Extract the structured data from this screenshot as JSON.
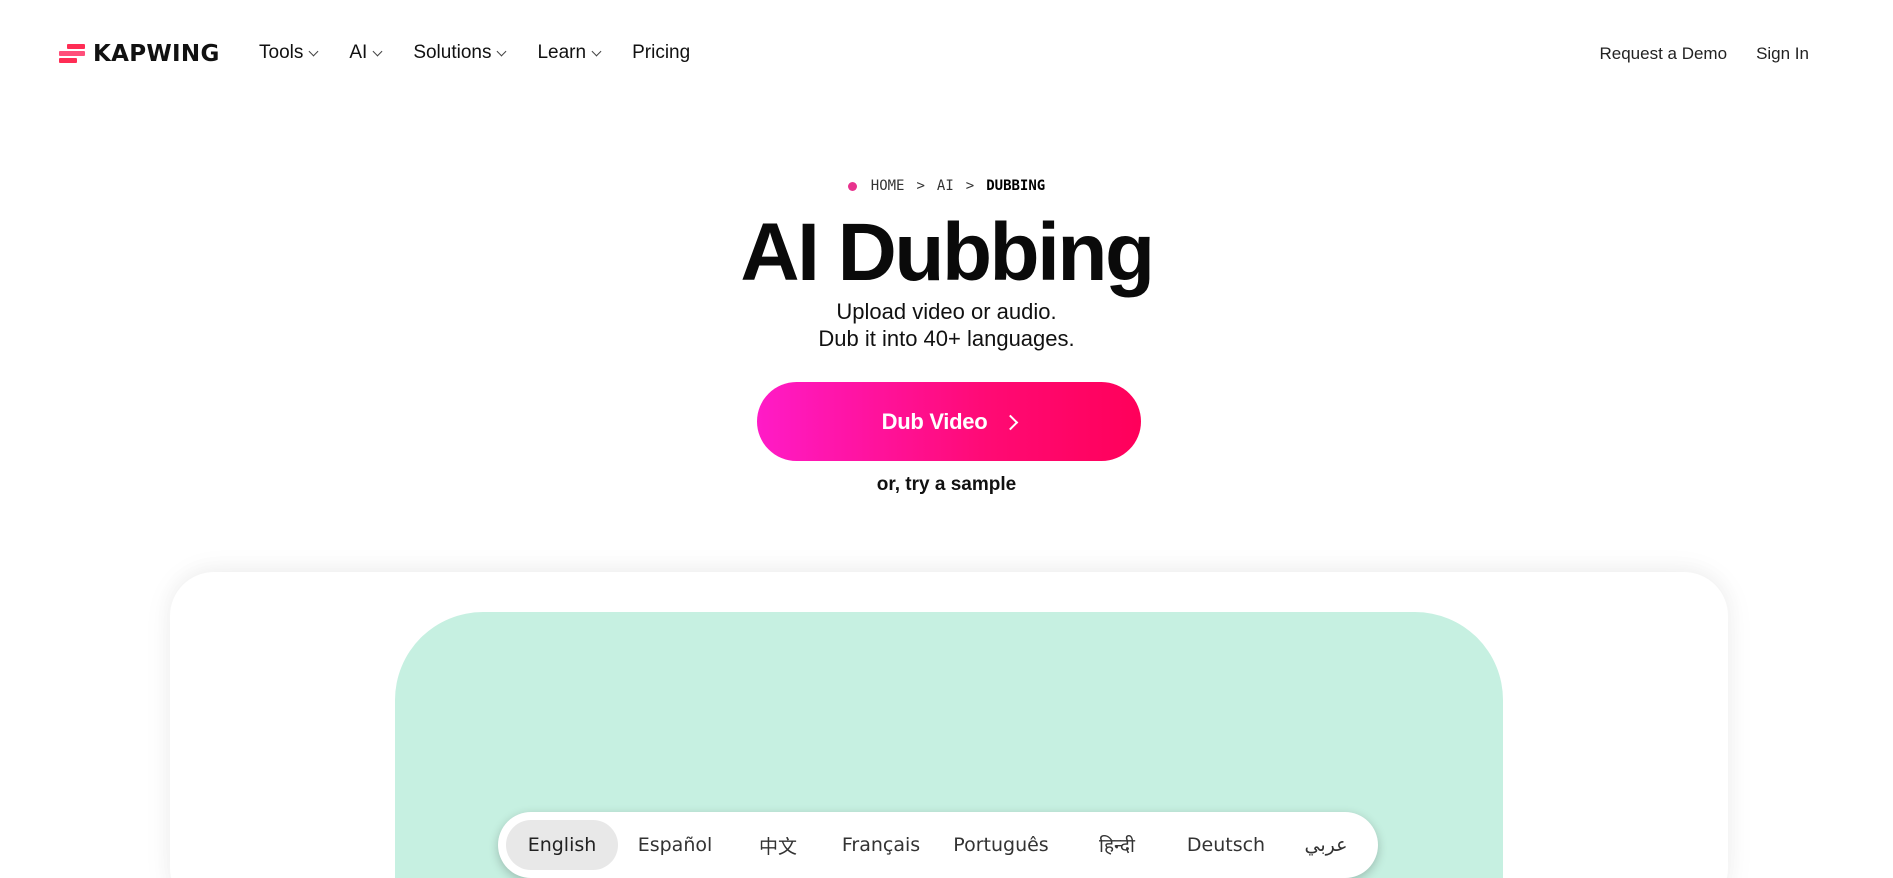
{
  "brand": {
    "name": "KAPWING",
    "colors": {
      "accent": "#ff0a74",
      "accent_start": "#ff1bc7",
      "mint": "#c6f0e1",
      "breadcrumb_dot": "#e8338e"
    }
  },
  "nav": {
    "links": [
      {
        "label": "Tools",
        "has_dropdown": true
      },
      {
        "label": "AI",
        "has_dropdown": true
      },
      {
        "label": "Solutions",
        "has_dropdown": true
      },
      {
        "label": "Learn",
        "has_dropdown": true
      },
      {
        "label": "Pricing",
        "has_dropdown": false
      }
    ],
    "request_demo": "Request a Demo",
    "sign_in": "Sign In"
  },
  "breadcrumb": {
    "items": [
      "HOME",
      "AI",
      "DUBBING"
    ],
    "separator": ">"
  },
  "hero": {
    "title": "AI Dubbing",
    "subtitle_line1": "Upload video or audio.",
    "subtitle_line2": "Dub it into 40+ languages.",
    "cta_label": "Dub Video",
    "sample_label": "or, try a sample"
  },
  "languages": {
    "active": "English",
    "items": [
      "English",
      "Español",
      "中文",
      "Français",
      "Português",
      "हिन्दी",
      "Deutsch",
      "عربي"
    ]
  }
}
